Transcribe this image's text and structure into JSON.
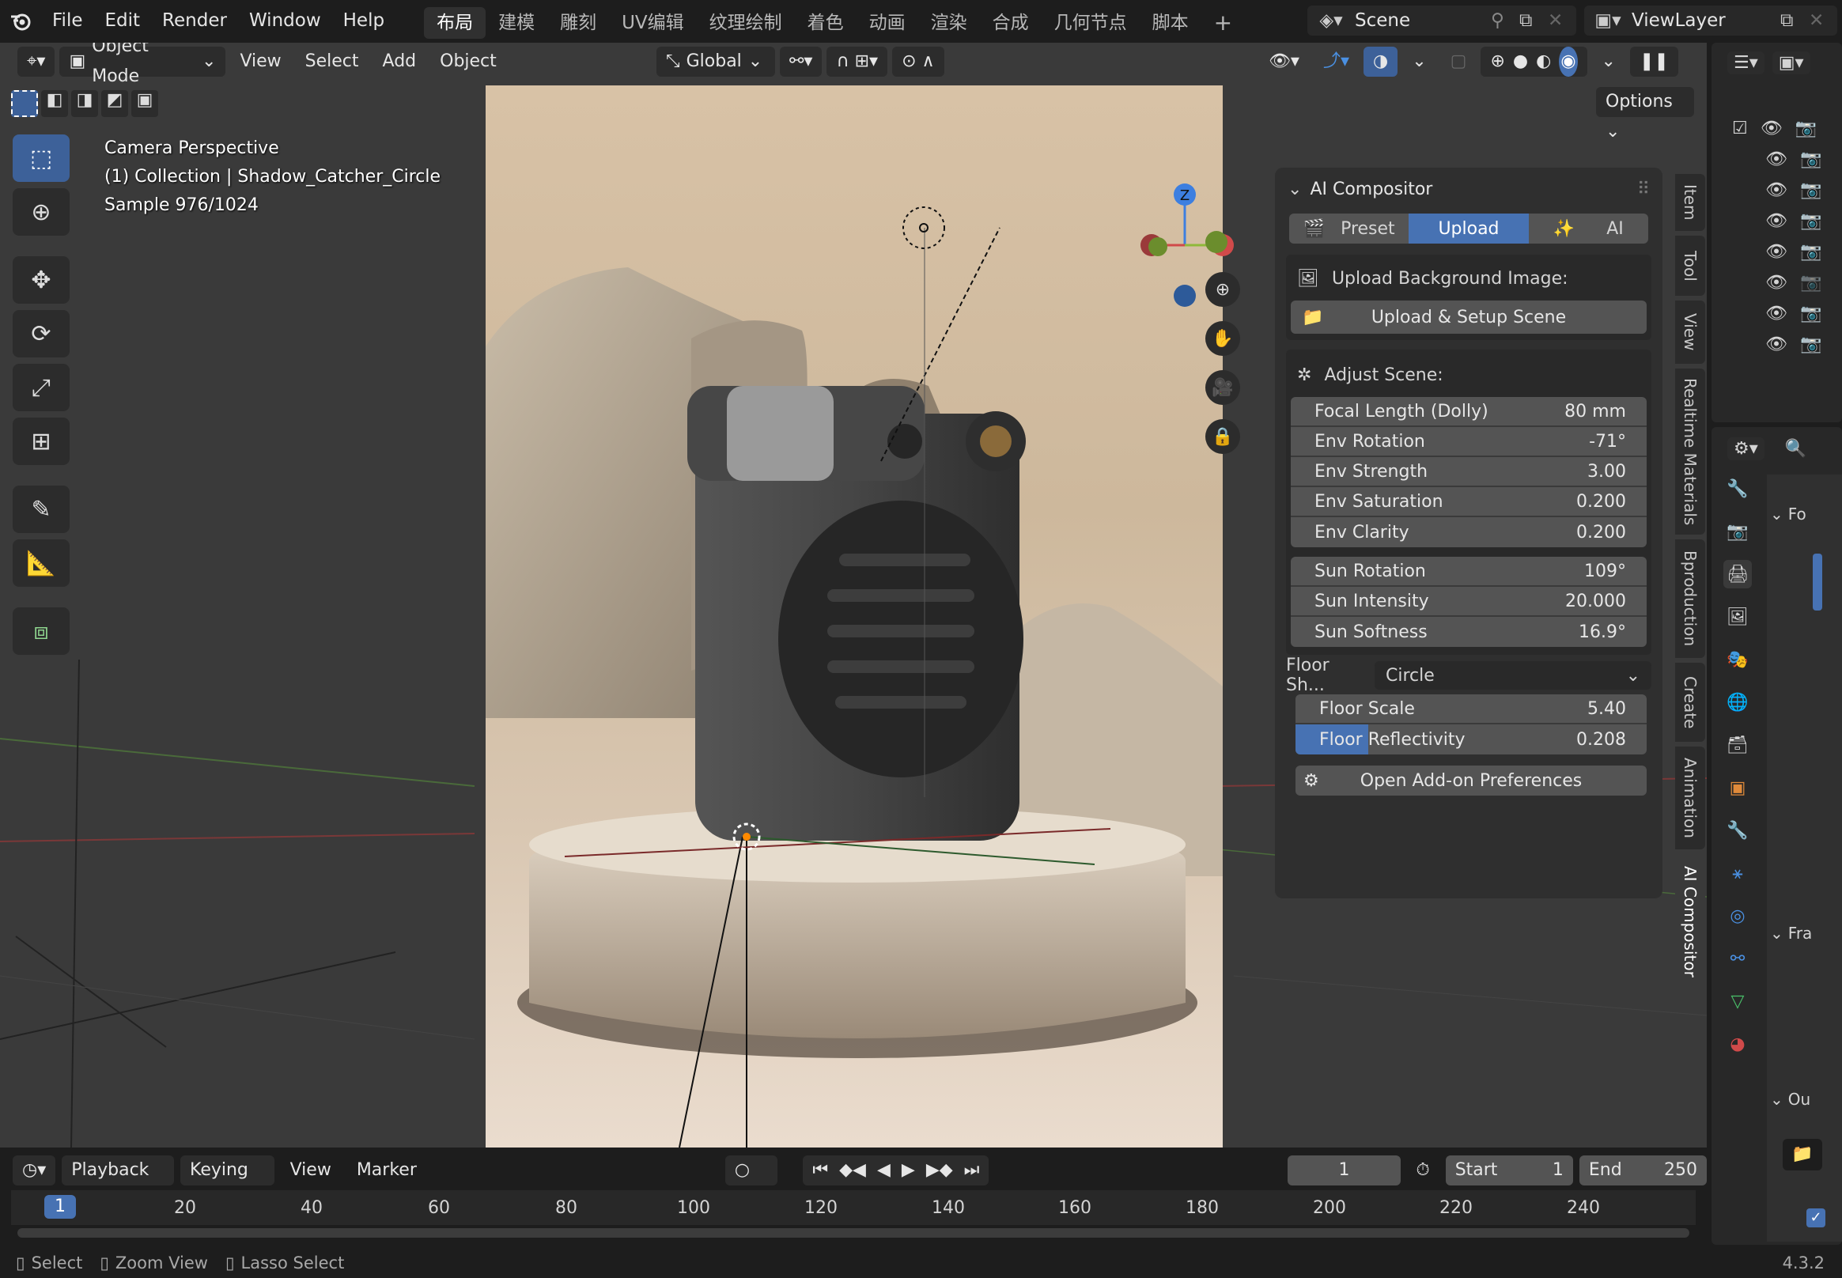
{
  "topbar": {
    "menus": [
      "File",
      "Edit",
      "Render",
      "Window",
      "Help"
    ],
    "workspaces": [
      "布局",
      "建模",
      "雕刻",
      "UV编辑",
      "纹理绘制",
      "着色",
      "动画",
      "渲染",
      "合成",
      "几何节点",
      "脚本"
    ],
    "active_workspace": "布局",
    "scene": "Scene",
    "view_layer": "ViewLayer"
  },
  "viewport_header": {
    "mode": "Object Mode",
    "menus": [
      "View",
      "Select",
      "Add",
      "Object"
    ],
    "orientation": "Global",
    "options": "Options"
  },
  "overlay_text": {
    "line1": "Camera Perspective",
    "line2": "(1) Collection | Shadow_Catcher_Circle",
    "line3": "Sample 976/1024"
  },
  "gizmo": {
    "z": "Z"
  },
  "ai_panel": {
    "title": "AI Compositor",
    "tabs": [
      "Preset",
      "Upload",
      "AI"
    ],
    "active_tab": "Upload",
    "upload_label": "Upload Background Image:",
    "upload_button": "Upload & Setup Scene",
    "adjust_label": "Adjust Scene:",
    "env_rows": [
      {
        "label": "Focal Length (Dolly)",
        "value": "80 mm"
      },
      {
        "label": "Env Rotation",
        "value": "-71°"
      },
      {
        "label": "Env Strength",
        "value": "3.00"
      },
      {
        "label": "Env Saturation",
        "value": "0.200"
      },
      {
        "label": "Env Clarity",
        "value": "0.200"
      }
    ],
    "sun_rows": [
      {
        "label": "Sun Rotation",
        "value": "109°"
      },
      {
        "label": "Sun Intensity",
        "value": "20.000"
      },
      {
        "label": "Sun Softness",
        "value": "16.9°"
      }
    ],
    "floor_shape_label": "Floor Sh...",
    "floor_shape_value": "Circle",
    "floor_rows": [
      {
        "label": "Floor Scale",
        "value": "5.40"
      },
      {
        "label": "Floor Reflectivity",
        "value": "0.208",
        "fill": 0.208
      }
    ],
    "prefs_button": "Open Add-on Preferences"
  },
  "side_tabs": [
    "Item",
    "Tool",
    "View",
    "Realtime Materials",
    "Bproduction",
    "Create",
    "Animation",
    "AI Compositor"
  ],
  "active_side_tab": "AI Compositor",
  "properties": {
    "sec1": "Fo",
    "sec2": "Fra",
    "sec3": "Ou"
  },
  "timeline": {
    "menus": [
      "Playback",
      "Keying",
      "View",
      "Marker"
    ],
    "current_frame": "1",
    "start_label": "Start",
    "start": "1",
    "end_label": "End",
    "end": "250",
    "ticks": [
      "1",
      "20",
      "40",
      "60",
      "80",
      "100",
      "120",
      "140",
      "160",
      "180",
      "200",
      "220",
      "240"
    ]
  },
  "status": {
    "items": [
      "Select",
      "Zoom View",
      "Lasso Select"
    ],
    "version": "4.3.2"
  },
  "colors": {
    "accent": "#4772b3",
    "active_tool": "#3d6199",
    "panel_bg": "#2f2f2f",
    "row_bg": "#545454"
  }
}
